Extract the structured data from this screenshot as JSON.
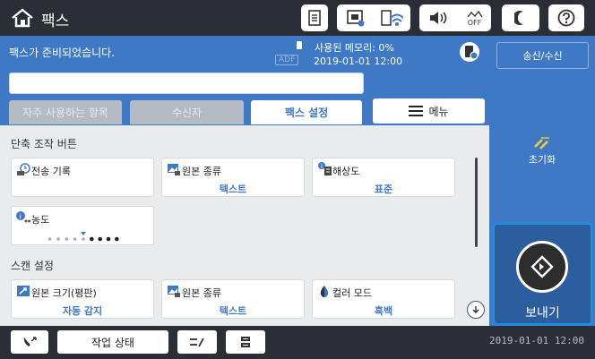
{
  "app": {
    "title": "팩스"
  },
  "status": {
    "fax_ready": "팩스가 준비되었습니다.",
    "memory_used": "사용된 메모리: 0%",
    "adf_badge": "ADF",
    "datetime": "2019-01-01 12:00"
  },
  "toolbar": {
    "wifi_off_label": "OFF"
  },
  "number_field": {
    "value": ""
  },
  "tabs": [
    {
      "label": "자주 사용하는 항목",
      "active": false
    },
    {
      "label": "수신자",
      "active": false
    },
    {
      "label": "팩스 설정",
      "active": true
    }
  ],
  "menu": {
    "label": "메뉴"
  },
  "quick_ops": {
    "title": "단축 조작 버튼",
    "tiles": [
      {
        "label": "전송 기록",
        "value": "",
        "icon": "send-history-icon"
      },
      {
        "label": "원본 종류",
        "value": "텍스트",
        "icon": "original-type-icon"
      },
      {
        "label": "해상도",
        "value": "표준",
        "icon": "resolution-icon"
      },
      {
        "label": "농도",
        "value": "",
        "icon": "density-icon"
      }
    ],
    "density_level": 5,
    "density_steps": 9
  },
  "scan_settings": {
    "title": "스캔 설정",
    "tiles": [
      {
        "label": "원본 크기(평판)",
        "value": "자동 감지",
        "icon": "original-size-icon"
      },
      {
        "label": "원본 종류",
        "value": "텍스트",
        "icon": "original-type-icon"
      },
      {
        "label": "컬러 모드",
        "value": "흑백",
        "icon": "color-mode-icon"
      }
    ]
  },
  "right_panel": {
    "send_receive": "송신/수신",
    "reset": "초기화",
    "send": "보내기"
  },
  "bottom": {
    "job_status": "작업 상태",
    "datetime": "2019-01-01 12:00"
  },
  "colors": {
    "accent": "#3f79c5",
    "dark": "#2b2e35",
    "highlight": "#1f8ce0",
    "reset_icon": "#e6d43a"
  }
}
